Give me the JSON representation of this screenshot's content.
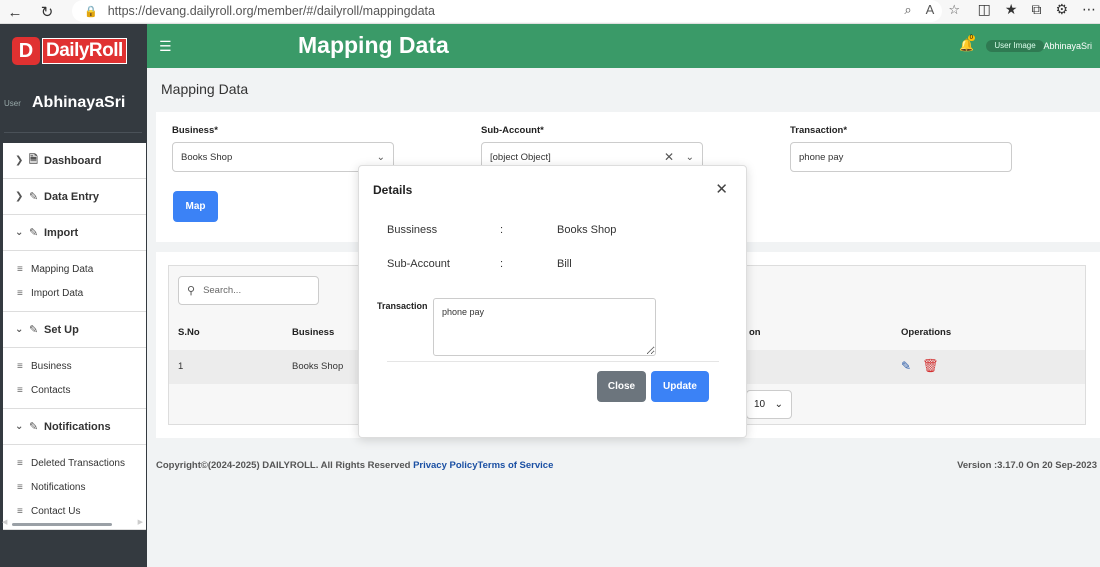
{
  "browser": {
    "url": "https://devang.dailyroll.org/member/#/dailyroll/mappingdata"
  },
  "sidebar": {
    "logo_text": "DailyRoll",
    "user_image_alt": "User",
    "user_name": "AbhinayaSri",
    "menu": [
      {
        "label": "Dashboard",
        "expanded": false,
        "items": []
      },
      {
        "label": "Data Entry",
        "expanded": false,
        "items": []
      },
      {
        "label": "Import",
        "expanded": true,
        "items": [
          "Mapping Data",
          "Import Data"
        ]
      },
      {
        "label": "Set Up",
        "expanded": true,
        "items": [
          "Business",
          "Contacts"
        ]
      },
      {
        "label": "Notifications",
        "expanded": true,
        "items": [
          "Deleted Transactions",
          "Notifications",
          "Contact Us"
        ]
      }
    ]
  },
  "header": {
    "title": "Mapping Data",
    "badge": "0",
    "user_image_alt": "User Image",
    "user_name": "AbhinayaSri"
  },
  "page": {
    "title": "Mapping Data",
    "business_label": "Business*",
    "business_value": "Books Shop",
    "subaccount_label": "Sub-Account*",
    "subaccount_value": "[object Object]",
    "transaction_label": "Transaction*",
    "transaction_value": "phone pay",
    "map_button": "Map"
  },
  "table": {
    "search_placeholder": "Search...",
    "columns": [
      "S.No",
      "Business",
      "on",
      "Operations"
    ],
    "rows": [
      {
        "sno": "1",
        "business": "Books Shop"
      }
    ],
    "page_size": "10"
  },
  "footer": {
    "copyright": "Copyright©(2024-2025) DAILYROLL. All Rights Reserved ",
    "privacy": "Privacy Policy",
    "terms": "Terms of Service",
    "version": "Version :3.17.0 On 20 Sep-2023"
  },
  "modal": {
    "title": "Details",
    "bussiness_label": "Bussiness",
    "bussiness_value": "Books Shop",
    "subaccount_label": "Sub-Account",
    "subaccount_value": "Bill",
    "colon": ":",
    "transaction_label": "Transaction",
    "transaction_value": "phone pay",
    "close_button": "Close",
    "update_button": "Update"
  },
  "colors": {
    "header_green": "#3a9a68",
    "sidebar_dark": "#343a40",
    "primary_blue": "#3b82f6",
    "secondary_gray": "#6c757d",
    "delete_red": "#d32f2f"
  }
}
